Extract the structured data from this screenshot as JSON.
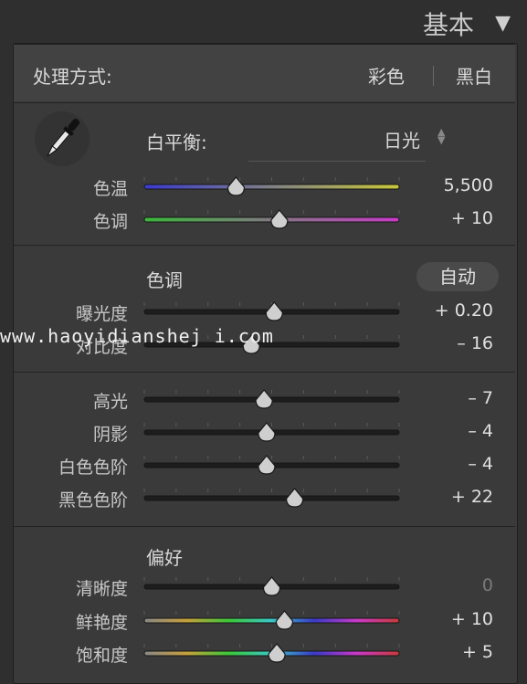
{
  "header": {
    "title": "基本",
    "collapse_icon": "triangle-down-icon"
  },
  "treatment": {
    "label": "处理方式:",
    "options": [
      "彩色",
      "黑白"
    ],
    "selected": "彩色"
  },
  "white_balance": {
    "label": "白平衡:",
    "value": "日光",
    "picker_icon": "eyedropper-icon",
    "sliders": [
      {
        "label": "色温",
        "value": "5,500",
        "pos": 0.36,
        "track": [
          "#3a3ad0",
          "#c8c83a"
        ]
      },
      {
        "label": "色调",
        "value": "+ 10",
        "pos": 0.53,
        "track": [
          "#3ab83a",
          "#c83ac8"
        ]
      }
    ]
  },
  "tone": {
    "label": "色调",
    "auto_label": "自动",
    "sliders_a": [
      {
        "label": "曝光度",
        "value": "+ 0.20",
        "pos": 0.51
      },
      {
        "label": "对比度",
        "value": "– 16",
        "pos": 0.42
      }
    ],
    "sliders_b": [
      {
        "label": "高光",
        "value": "– 7",
        "pos": 0.47
      },
      {
        "label": "阴影",
        "value": "– 4",
        "pos": 0.48
      },
      {
        "label": "白色色阶",
        "value": "– 4",
        "pos": 0.48
      },
      {
        "label": "黑色色阶",
        "value": "+ 22",
        "pos": 0.59
      }
    ]
  },
  "presence": {
    "label": "偏好",
    "sliders": [
      {
        "label": "清晰度",
        "value": "0",
        "pos": 0.5,
        "dim": true
      },
      {
        "label": "鲜艳度",
        "value": "+ 10",
        "pos": 0.55,
        "rainbow": true
      },
      {
        "label": "饱和度",
        "value": "+ 5",
        "pos": 0.52,
        "rainbow": true
      }
    ]
  },
  "watermark": "www.haoyidianshej i.com"
}
